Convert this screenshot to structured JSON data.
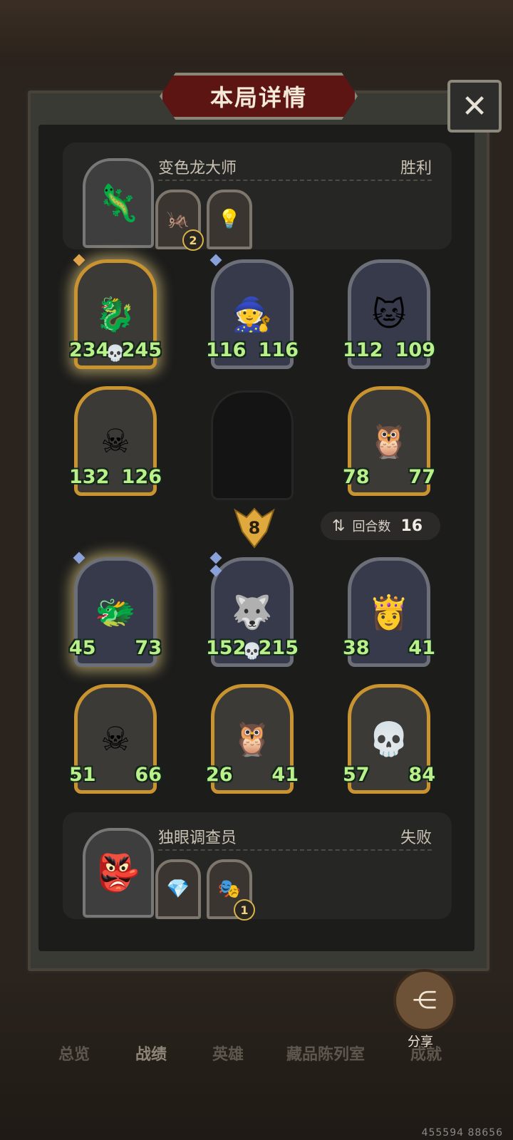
{
  "dialog": {
    "title": "本局详情",
    "close_icon": "close-icon"
  },
  "winner": {
    "name": "变色龙大师",
    "result": "胜利",
    "relics": [
      {
        "icon": "bug-cage-icon",
        "count": "2"
      },
      {
        "icon": "lightbulb-icon",
        "count": ""
      }
    ]
  },
  "loser": {
    "name": "独眼调查员",
    "result": "失败",
    "relics": [
      {
        "icon": "crystal-icon",
        "count": ""
      },
      {
        "icon": "golden-mask-icon",
        "count": "1"
      }
    ]
  },
  "rank": "8",
  "rounds": {
    "label": "回合数",
    "value": "16"
  },
  "winner_units": [
    {
      "atk": "234",
      "hp": "245",
      "frame": "gold",
      "icon": "blue-dragon-icon",
      "skull": true
    },
    {
      "atk": "116",
      "hp": "116",
      "frame": "silver",
      "icon": "wizard-girl-icon",
      "skull": false
    },
    {
      "atk": "112",
      "hp": "109",
      "frame": "silver",
      "icon": "ghost-cat-icon",
      "skull": false
    },
    {
      "atk": "132",
      "hp": "126",
      "frame": "gold",
      "icon": "skull-mage-icon",
      "skull": false
    },
    {
      "atk": "78",
      "hp": "77",
      "frame": "gold",
      "icon": "owl-beast-icon",
      "skull": false
    }
  ],
  "loser_units": [
    {
      "atk": "45",
      "hp": "73",
      "frame": "silver",
      "icon": "green-dragon-icon",
      "skull": false
    },
    {
      "atk": "152",
      "hp": "215",
      "frame": "silver",
      "icon": "crescent-wolf-icon",
      "skull": true
    },
    {
      "atk": "38",
      "hp": "41",
      "frame": "silver",
      "icon": "priestess-icon",
      "skull": false
    },
    {
      "atk": "51",
      "hp": "66",
      "frame": "gold",
      "icon": "skull-mage-icon",
      "skull": false
    },
    {
      "atk": "26",
      "hp": "41",
      "frame": "gold",
      "icon": "owl-beast-icon",
      "skull": false
    },
    {
      "atk": "57",
      "hp": "84",
      "frame": "gold",
      "icon": "reaper-icon",
      "skull": false
    }
  ],
  "share_label": "分享",
  "tabs": [
    "总览",
    "战绩",
    "英雄",
    "藏品陈列室",
    "成就"
  ],
  "uid": "455594 88656"
}
